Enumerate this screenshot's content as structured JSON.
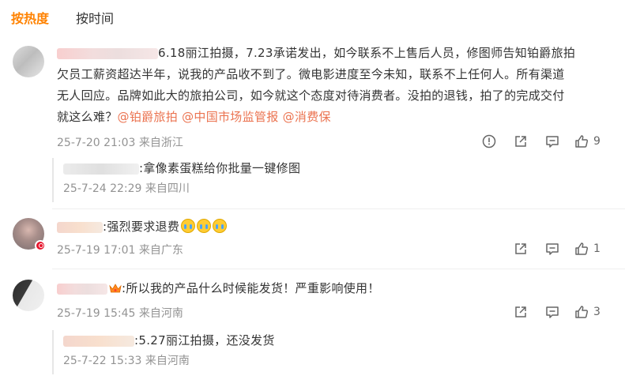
{
  "tabs": [
    {
      "label": "按热度",
      "active": true
    },
    {
      "label": "按时间",
      "active": false
    }
  ],
  "comments": [
    {
      "text_line1": "6.18丽江拍摄，7.23承诺发出，如今联系不上售后人员，修图师告知铂爵旅拍",
      "text_line2": "欠员工薪资超达半年，说我的产品收不到了。微电影进度至今未知，联系不上任何人。所有渠道",
      "text_line3": "无人回应。品牌如此大的旅拍公司，如今就这个态度对待消费者。没拍的退钱，拍了的完成交付",
      "text_line4_prefix": "就这么难？",
      "mentions": [
        "@铂爵旅拍",
        "@中国市场监管报",
        "@消费保"
      ],
      "meta": "25-7-20 21:03 来自浙江",
      "likes": "9",
      "reply": {
        "text": ":拿像素蛋糕给你批量一键修图",
        "meta": "25-7-24 22:29 来自四川"
      }
    },
    {
      "text": ":强烈要求退费",
      "meta": "25-7-19 17:01 来自广东",
      "likes": "1"
    },
    {
      "text": ":所以我的产品什么时候能发货！严重影响使用！",
      "meta": "25-7-19 15:45 来自河南",
      "likes": "3",
      "reply": {
        "text": ":5.27丽江拍摄，还没发货",
        "meta": "25-7-22 15:33 来自河南"
      }
    }
  ],
  "colors": {
    "accent": "#ff8200",
    "mention": "#eb7350",
    "meta": "#939393",
    "text": "#333333"
  },
  "icons": [
    "report-icon",
    "share-icon",
    "comment-icon",
    "like-icon",
    "verified-badge-icon",
    "crown-icon",
    "crying-emoji-icon"
  ]
}
